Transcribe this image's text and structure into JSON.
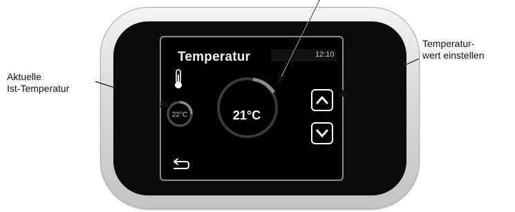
{
  "screen": {
    "title": "Temperatur",
    "time": "12:10",
    "current_temp": "22°C",
    "target_temp": "21°C"
  },
  "callouts": {
    "left": [
      "Aktuelle",
      "Ist-Temperatur"
    ],
    "right": [
      "Temperatur-",
      "wert einstellen"
    ]
  },
  "icons": {
    "thermometer": "thermometer-icon",
    "arrow_up": "arrow-up-icon",
    "arrow_down": "arrow-down-icon",
    "back": "back-arrow-icon"
  },
  "colors": {
    "screen_bg": "#000000",
    "text": "#ffffff",
    "ring": "#4a4a4a",
    "ring_active": "#8a8a8a"
  }
}
